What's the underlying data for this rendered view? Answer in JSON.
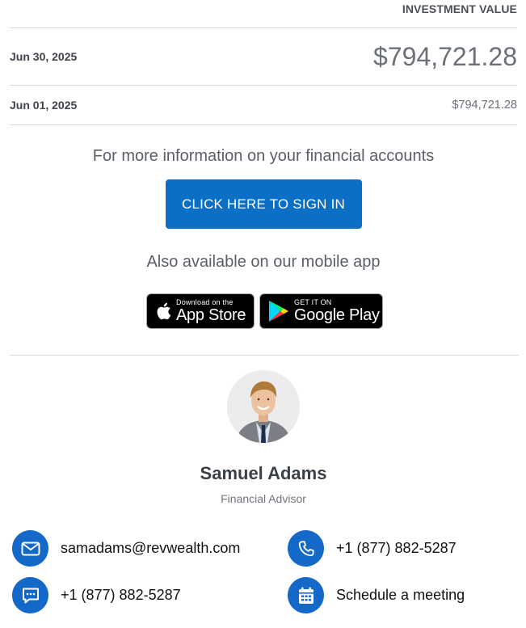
{
  "table": {
    "header": "INVESTMENT VALUE",
    "rows": [
      {
        "date": "Jun 30, 2025",
        "value": "$794,721.28"
      },
      {
        "date": "Jun 01, 2025",
        "value": "$794,721.28"
      }
    ]
  },
  "signin": {
    "info_text": "For more information on your financial accounts",
    "button_label": "CLICK HERE TO SIGN IN",
    "mobile_text": "Also available on our mobile app"
  },
  "badges": {
    "apple": {
      "small": "Download on the",
      "big": "App Store"
    },
    "google": {
      "small": "GET IT ON",
      "big": "Google Play"
    }
  },
  "advisor": {
    "name": "Samuel Adams",
    "title": "Financial Advisor"
  },
  "contacts": {
    "email": "samadams@revwealth.com",
    "phone": "+1 (877) 882-5287",
    "sms": "+1 (877) 882-5287",
    "meeting": "Schedule a meeting"
  },
  "colors": {
    "primary_button": "#0a6fc5",
    "contact_icon_bg": "#1468c8"
  }
}
